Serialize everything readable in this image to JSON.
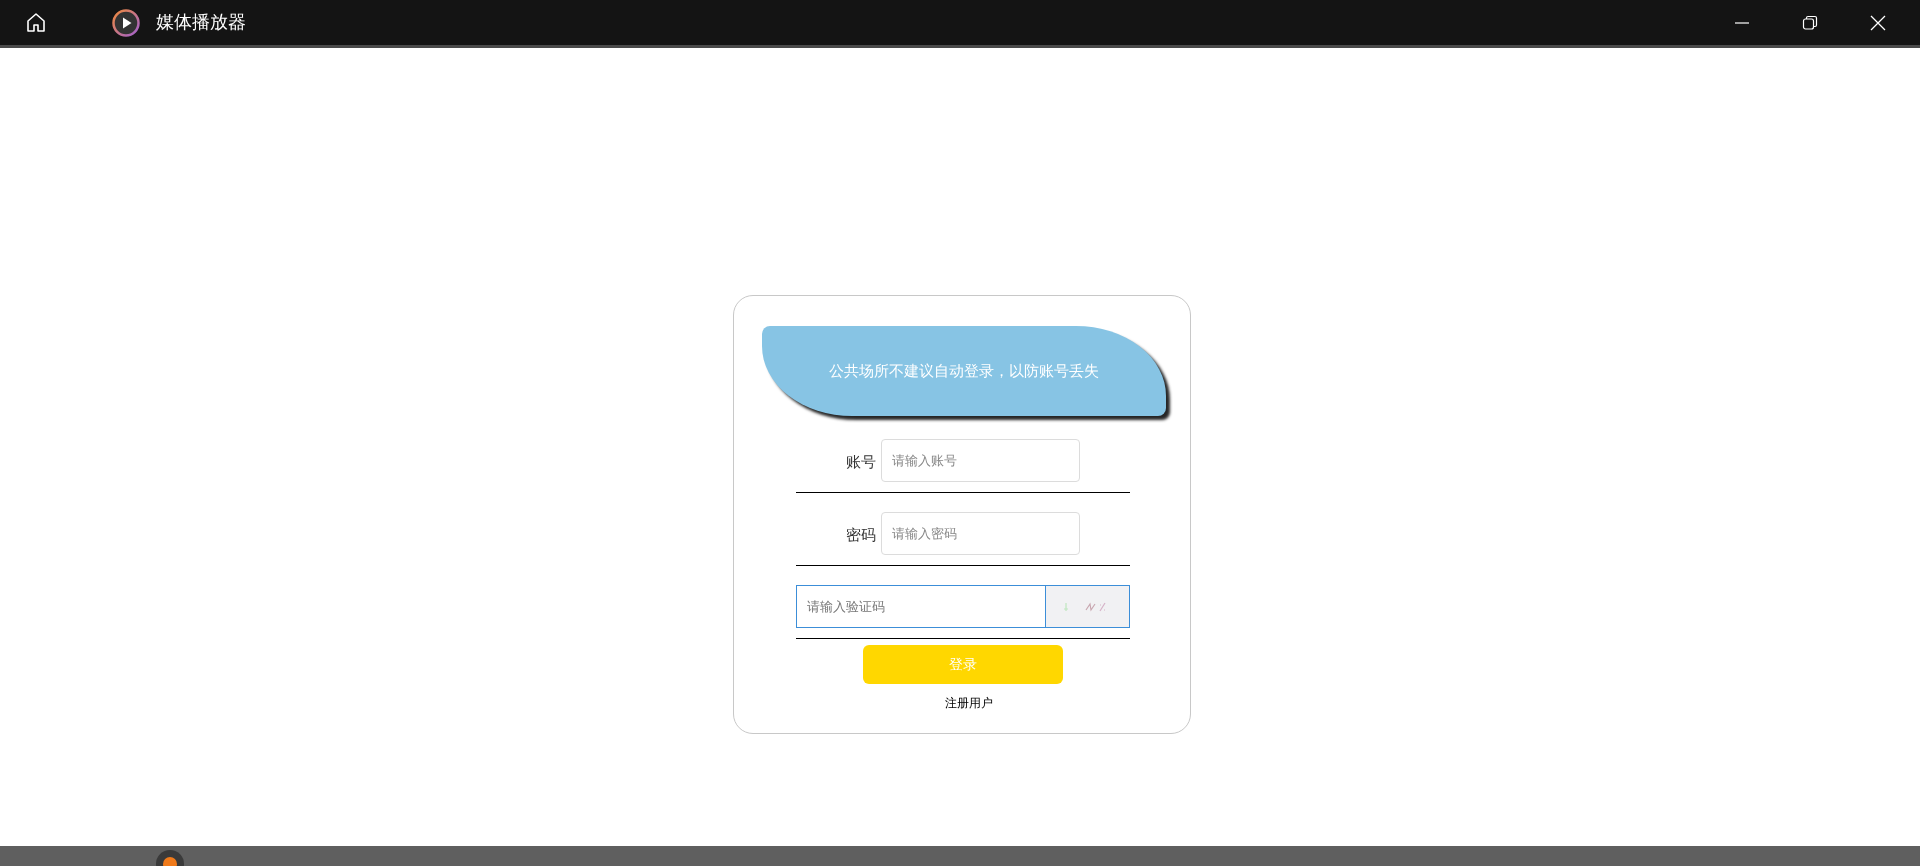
{
  "window": {
    "title": "媒体播放器"
  },
  "login": {
    "notice": "公共场所不建议自动登录，以防账号丢失",
    "fields": [
      {
        "label": "账号",
        "placeholder": "请输入账号"
      },
      {
        "label": "密码",
        "placeholder": "请输入密码"
      }
    ],
    "captcha": {
      "placeholder": "请输入验证码"
    },
    "submit": "登录",
    "register": "注册用户"
  }
}
